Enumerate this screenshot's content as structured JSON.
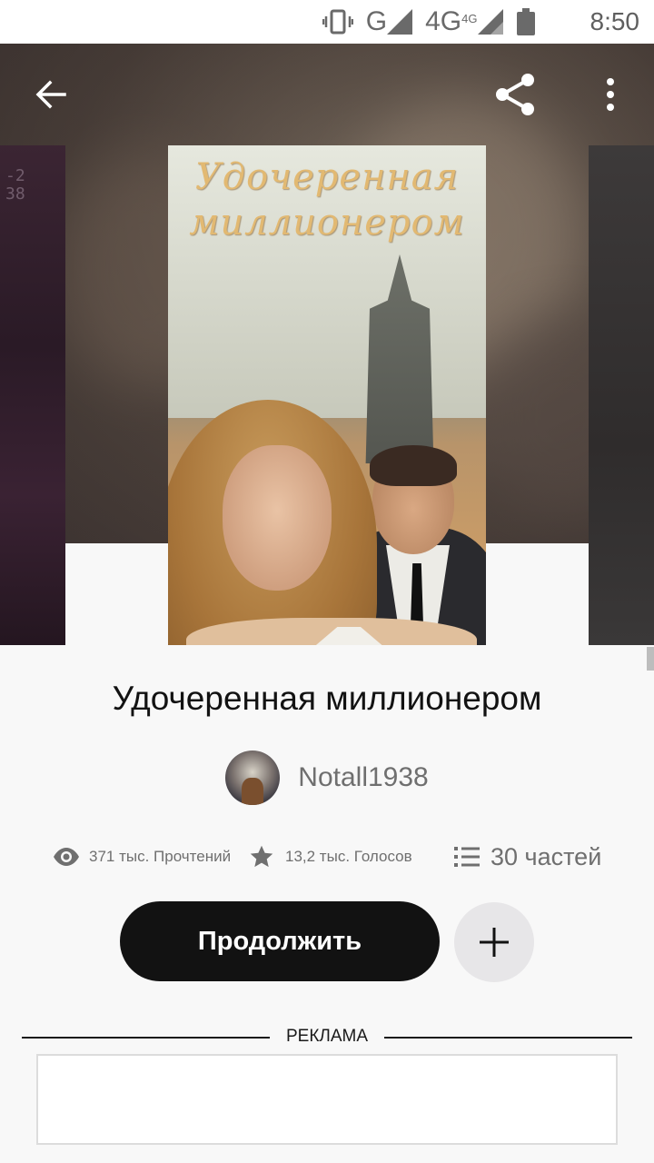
{
  "status_bar": {
    "network_g": "G",
    "network_4g": "4G",
    "network_4g_small": "4G",
    "time": "8:50"
  },
  "toolbar": {
    "back_icon": "arrow-left-icon",
    "share_icon": "share-icon",
    "more_icon": "more-vertical-icon"
  },
  "cover": {
    "title_line1": "Удочеренная",
    "title_line2": "миллионером",
    "side_left_text": "2\n38"
  },
  "story": {
    "title": "Удочеренная миллионером",
    "author": "Notall1938"
  },
  "stats": {
    "reads": "371 тыс. Прочтений",
    "votes": "13,2 тыс. Голосов",
    "parts": "30 частей"
  },
  "actions": {
    "continue_label": "Продолжить",
    "add_icon": "plus-icon"
  },
  "ad": {
    "label": "РЕКЛАМА"
  },
  "colors": {
    "primary_button": "#121212",
    "secondary_button": "#e7e6e8",
    "muted_text": "#6f6f6f"
  }
}
